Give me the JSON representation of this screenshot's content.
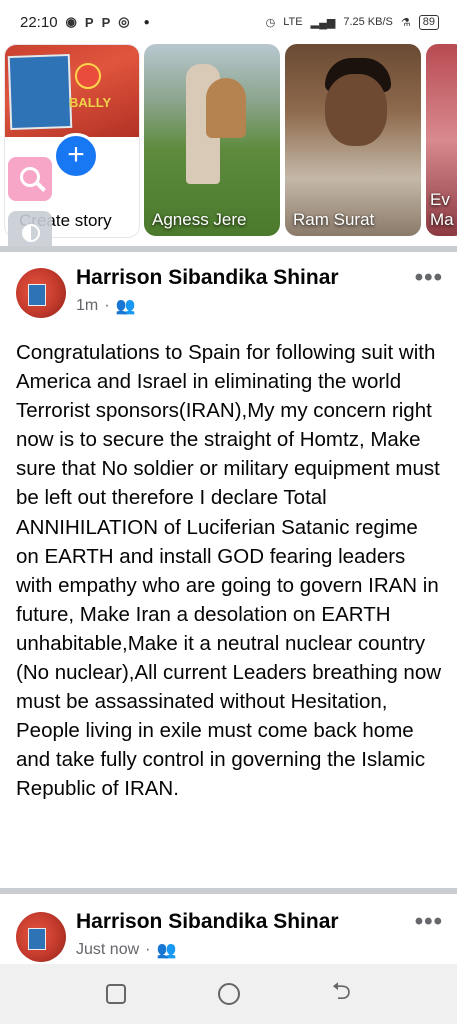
{
  "status_bar": {
    "time": "22:10",
    "notification_icons": [
      "messenger-icon",
      "p-icon",
      "p-icon",
      "whatsapp-icon"
    ],
    "network": "LTE",
    "speed": "7.25 KB/S",
    "battery": "89"
  },
  "stories": [
    {
      "label": "Create story",
      "type": "create"
    },
    {
      "label": "Agness Jere"
    },
    {
      "label": "Ram Surat"
    },
    {
      "label": "Ev Ma"
    }
  ],
  "create_story": {
    "sticker_text": "BALLY",
    "plus_icon": "+"
  },
  "posts": [
    {
      "author": "Harrison Sibandika Shinar",
      "time": "1m",
      "audience_icon": "friends-icon",
      "more": "•••",
      "text": "Congratulations to Spain for following suit with America and Israel in eliminating the world Terrorist sponsors(IRAN),My my concern right now is to secure the straight of Homtz, Make sure that No soldier or military equipment must be left out therefore I declare Total ANNIHILATION of Luciferian Satanic regime on EARTH and install GOD fearing leaders with empathy who are going to govern IRAN in future, Make Iran a desolation on EARTH unhabitable,Make it a neutral nuclear country (No nuclear),All current Leaders breathing now must be assassinated without Hesitation, People living in exile must come back home and take fully control in governing the Islamic Republic of IRAN."
    },
    {
      "author": "Harrison Sibandika Shinar",
      "time": "Just now",
      "audience_icon": "friends-icon",
      "more": "•••"
    }
  ],
  "colors": {
    "accent": "#1877f2",
    "divider": "#c9ccd1",
    "meta": "#65676b"
  }
}
